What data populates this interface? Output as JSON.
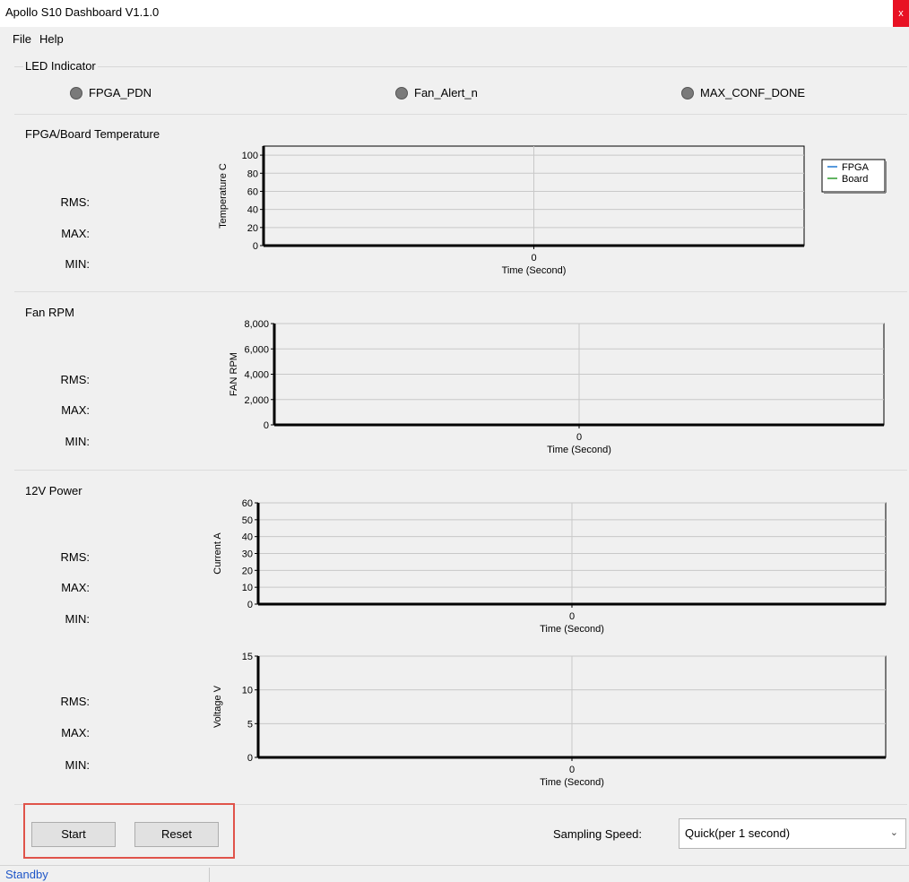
{
  "window": {
    "title": "Apollo S10 Dashboard  V1.1.0",
    "close_label": "x"
  },
  "menu": {
    "file": "File",
    "help": "Help"
  },
  "led_indicator": {
    "title": "LED Indicator",
    "leds": [
      {
        "label": "FPGA_PDN",
        "color": "#7a7a7a"
      },
      {
        "label": "Fan_Alert_n",
        "color": "#7a7a7a"
      },
      {
        "label": "MAX_CONF_DONE",
        "color": "#7a7a7a"
      }
    ]
  },
  "stats_labels": {
    "rms": "RMS:",
    "max": "MAX:",
    "min": "MIN:"
  },
  "sections": {
    "temperature": {
      "title": "FPGA/Board Temperature"
    },
    "fan": {
      "title": "Fan RPM"
    },
    "power": {
      "title": "12V Power"
    }
  },
  "chart_data": [
    {
      "type": "line",
      "ylabel": "Temperature C",
      "xlabel": "Time (Second)",
      "x_ticks": [
        "0"
      ],
      "y_ticks": [
        "0",
        "20",
        "40",
        "60",
        "80",
        "100"
      ],
      "ylim": [
        0,
        110
      ],
      "grid": true,
      "legend_position": "right",
      "series": [
        {
          "name": "FPGA",
          "color": "#1f77d0",
          "values": []
        },
        {
          "name": "Board",
          "color": "#2e9a2e",
          "values": []
        }
      ]
    },
    {
      "type": "line",
      "ylabel": "FAN RPM",
      "xlabel": "Time (Second)",
      "x_ticks": [
        "0"
      ],
      "y_ticks": [
        "0",
        "2,000",
        "4,000",
        "6,000",
        "8,000"
      ],
      "ylim": [
        0,
        8000
      ],
      "grid": true,
      "series": []
    },
    {
      "type": "line",
      "ylabel": "Current A",
      "xlabel": "Time (Second)",
      "x_ticks": [
        "0"
      ],
      "y_ticks": [
        "0",
        "10",
        "20",
        "30",
        "40",
        "50",
        "60"
      ],
      "ylim": [
        0,
        60
      ],
      "grid": true,
      "series": []
    },
    {
      "type": "line",
      "ylabel": "Voltage V",
      "xlabel": "Time (Second)",
      "x_ticks": [
        "0"
      ],
      "y_ticks": [
        "0",
        "5",
        "10",
        "15"
      ],
      "ylim": [
        0,
        15
      ],
      "grid": true,
      "series": []
    }
  ],
  "controls": {
    "start_label": "Start",
    "reset_label": "Reset",
    "sampling_label": "Sampling Speed:",
    "sampling_value": "Quick(per 1 second)",
    "highlight_color": "#e0534a"
  },
  "status": {
    "text": "Standby"
  }
}
